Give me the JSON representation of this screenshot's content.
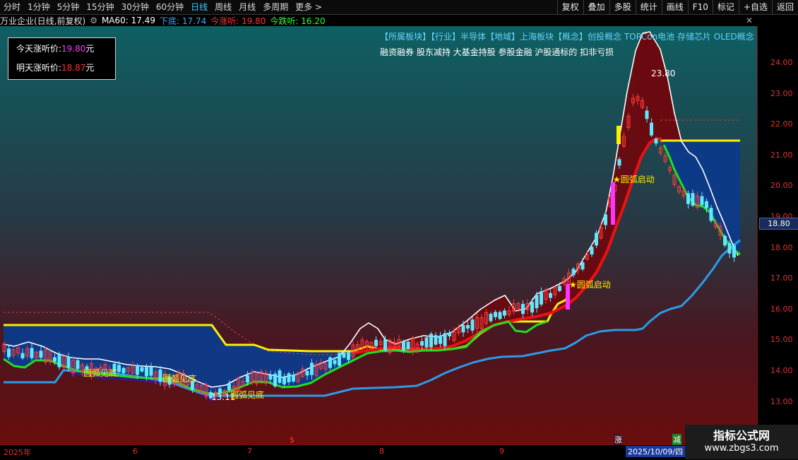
{
  "toolbar": {
    "left_items": [
      "分时",
      "1分钟",
      "5分钟",
      "15分钟",
      "30分钟",
      "60分钟",
      "日线",
      "周线",
      "月线",
      "多周期",
      "更多 >"
    ],
    "active_index": 6,
    "right_items": [
      "复权",
      "叠加",
      "多股",
      "统计",
      "画线",
      "F10",
      "标记",
      "+自选",
      "返回"
    ],
    "gear_icon": "⚙",
    "close_icon": "✕"
  },
  "info": {
    "title": "万业企业(日线,前复权)",
    "ma60": "MA60: 17.49",
    "xiadi": "下底: 17.74",
    "zhangting": "今涨听: 19.80",
    "dieting": "今跌听: 16.20",
    "colors": {
      "ma60": "#ffffff",
      "xiadi": "#33aaff",
      "zhangting": "#ff3333",
      "dieting": "#33ff33"
    }
  },
  "price_box": {
    "today_label": "今天涨听价:",
    "today_value": "19.80",
    "today_unit": "元",
    "tomorrow_label": "明天涨听价:",
    "tomorrow_value": "18.87",
    "tomorrow_unit": "元"
  },
  "concepts": {
    "line1": "【所属板块】【行业】半导体【地域】上海板块【概念】创投概念 TOPCon电池 存储芯片 OLED概念",
    "line2": "融资融券 股东减持 大基金持股 参股金融 沪股通标的 扣非亏损"
  },
  "axis": {
    "ticks": [
      "24.00",
      "23.00",
      "22.00",
      "21.00",
      "20.00",
      "19.00",
      "18.00",
      "17.00",
      "16.00",
      "15.00",
      "14.00",
      "13.00"
    ],
    "current_price": "18.80"
  },
  "annotations": {
    "high_label": "23.80",
    "low_label": "13.11",
    "signals": [
      "圆弧见底",
      "圆弧见底",
      "圆弧见底",
      "圆弧启动",
      "圆弧启动"
    ],
    "star": "★"
  },
  "bottom": {
    "dates": [
      "2025年",
      "6",
      "7",
      "8",
      "9"
    ],
    "marker_dollar": "$",
    "badge_zhang": "涨",
    "badge_jian": "减",
    "current_date": "2025/10/09/四"
  },
  "watermark": {
    "line1": "指标公式网",
    "line2": "www.zbgs3.com"
  }
}
